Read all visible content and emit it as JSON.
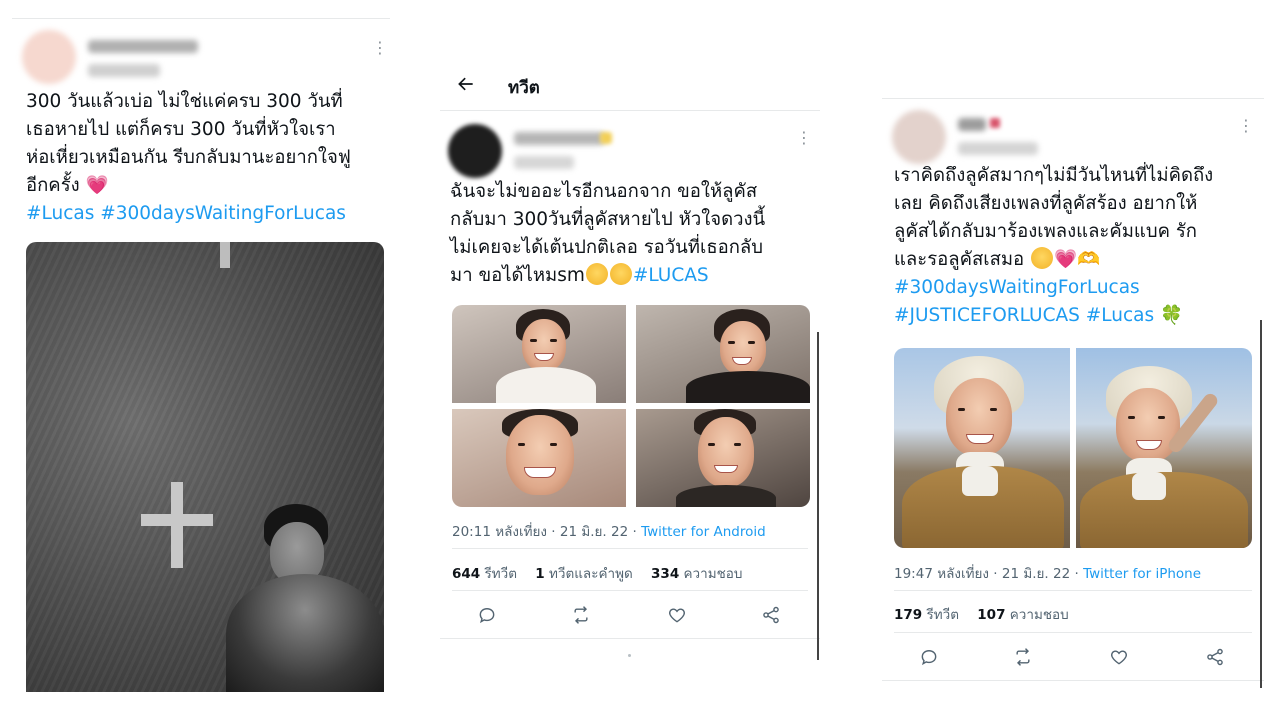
{
  "post1": {
    "text": "300 วันแล้วเบ่อ ไม่ใช่แค่ครบ 300 วันที่\nเธอหายไป แต่ก็ครบ 300 วันที่หัวใจเรา\nห่อเหี่ยวเหมือนกัน รีบกลับมานะอยากใจฟู\nอีกครั้ง ",
    "heart_emoji": "💗",
    "hashtags": "#Lucas #300daysWaitingForLucas"
  },
  "post2": {
    "header_title": "ทวีต",
    "text": "ฉันจะไม่ขออะไรอีกนอกจาก ขอให้ลูคัส\nกลับมา 300วันที่ลูคัสหายไป หัวใจดวงนี้\nไม่เคยจะได้เต้นปกติเลอ รอวันที่เธอกลับ\nมา ขอได้ไหมsm",
    "hashtag": "#LUCAS",
    "time": "20:11 หลังเที่ยง · 21 มิ.ย. 22 · ",
    "source": "Twitter for Android",
    "stats": {
      "retweets_count": "644",
      "retweets_label": "รีทวีต",
      "quotes_count": "1",
      "quotes_label": "ทวีตและคำพูด",
      "likes_count": "334",
      "likes_label": "ความชอบ"
    }
  },
  "post3": {
    "text": "เราคิดถึงลูคัสมากๆไม่มีวันไหนที่ไม่คิดถึง\nเลย คิดถึงเสียงเพลงที่ลูคัสร้อง อยากให้\nลูคัสได้กลับมาร้องเพลงและคัมแบค รัก\nและรอลูคัสเสมอ ",
    "heart_emoji": "💗",
    "handshake_emoji": "🫶",
    "hashtag_line1": "#300daysWaitingForLucas",
    "hashtag_line2": "#JUSTICEFORLUCAS #Lucas",
    "clover_emoji": "🍀",
    "time": "19:47 หลังเที่ยง · 21 มิ.ย. 22 · ",
    "source": "Twitter for iPhone",
    "stats": {
      "retweets_count": "179",
      "retweets_label": "รีทวีต",
      "likes_count": "107",
      "likes_label": "ความชอบ"
    }
  },
  "icons": [
    "more-icon",
    "back-arrow-icon",
    "reply-icon",
    "retweet-icon",
    "like-icon",
    "share-icon"
  ],
  "colors": {
    "link": "#1d9bf0",
    "text": "#0f1419",
    "muted": "#536471",
    "divider": "#e7e9ea"
  }
}
